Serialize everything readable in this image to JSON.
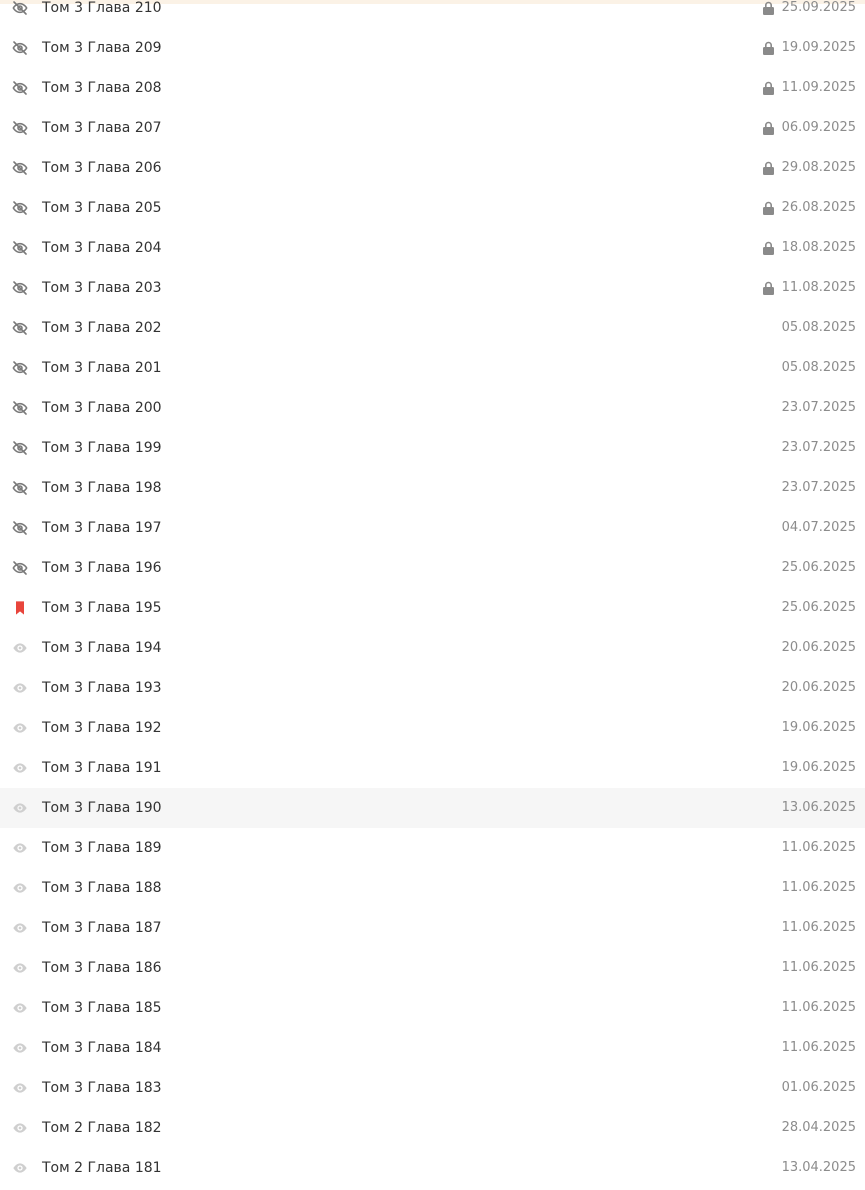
{
  "colors": {
    "title_text": "#333333",
    "date_text": "#8c8c8c",
    "icon_hidden": "#7a7a7a",
    "icon_eye": "#cfcfcf",
    "icon_bookmark": "#e8453c",
    "icon_lock": "#8a8a8a",
    "hover_row": "#f6f6f6",
    "top_strip": "#fbf2e6"
  },
  "chapters": [
    {
      "title": "Том 3 Глава 210",
      "date": "25.09.2025",
      "status_icon": "eye-off-icon",
      "locked": true
    },
    {
      "title": "Том 3 Глава 209",
      "date": "19.09.2025",
      "status_icon": "eye-off-icon",
      "locked": true
    },
    {
      "title": "Том 3 Глава 208",
      "date": "11.09.2025",
      "status_icon": "eye-off-icon",
      "locked": true
    },
    {
      "title": "Том 3 Глава 207",
      "date": "06.09.2025",
      "status_icon": "eye-off-icon",
      "locked": true
    },
    {
      "title": "Том 3 Глава 206",
      "date": "29.08.2025",
      "status_icon": "eye-off-icon",
      "locked": true
    },
    {
      "title": "Том 3 Глава 205",
      "date": "26.08.2025",
      "status_icon": "eye-off-icon",
      "locked": true
    },
    {
      "title": "Том 3 Глава 204",
      "date": "18.08.2025",
      "status_icon": "eye-off-icon",
      "locked": true
    },
    {
      "title": "Том 3 Глава 203",
      "date": "11.08.2025",
      "status_icon": "eye-off-icon",
      "locked": true
    },
    {
      "title": "Том 3 Глава 202",
      "date": "05.08.2025",
      "status_icon": "eye-off-icon",
      "locked": false
    },
    {
      "title": "Том 3 Глава 201",
      "date": "05.08.2025",
      "status_icon": "eye-off-icon",
      "locked": false
    },
    {
      "title": "Том 3 Глава 200",
      "date": "23.07.2025",
      "status_icon": "eye-off-icon",
      "locked": false
    },
    {
      "title": "Том 3 Глава 199",
      "date": "23.07.2025",
      "status_icon": "eye-off-icon",
      "locked": false
    },
    {
      "title": "Том 3 Глава 198",
      "date": "23.07.2025",
      "status_icon": "eye-off-icon",
      "locked": false
    },
    {
      "title": "Том 3 Глава 197",
      "date": "04.07.2025",
      "status_icon": "eye-off-icon",
      "locked": false
    },
    {
      "title": "Том 3 Глава 196",
      "date": "25.06.2025",
      "status_icon": "eye-off-icon",
      "locked": false
    },
    {
      "title": "Том 3 Глава 195",
      "date": "25.06.2025",
      "status_icon": "bookmark-icon",
      "locked": false
    },
    {
      "title": "Том 3 Глава 194",
      "date": "20.06.2025",
      "status_icon": "eye-icon",
      "locked": false
    },
    {
      "title": "Том 3 Глава 193",
      "date": "20.06.2025",
      "status_icon": "eye-icon",
      "locked": false
    },
    {
      "title": "Том 3 Глава 192",
      "date": "19.06.2025",
      "status_icon": "eye-icon",
      "locked": false
    },
    {
      "title": "Том 3 Глава 191",
      "date": "19.06.2025",
      "status_icon": "eye-icon",
      "locked": false
    },
    {
      "title": "Том 3 Глава 190",
      "date": "13.06.2025",
      "status_icon": "eye-icon",
      "locked": false,
      "hovered": true
    },
    {
      "title": "Том 3 Глава 189",
      "date": "11.06.2025",
      "status_icon": "eye-icon",
      "locked": false
    },
    {
      "title": "Том 3 Глава 188",
      "date": "11.06.2025",
      "status_icon": "eye-icon",
      "locked": false
    },
    {
      "title": "Том 3 Глава 187",
      "date": "11.06.2025",
      "status_icon": "eye-icon",
      "locked": false
    },
    {
      "title": "Том 3 Глава 186",
      "date": "11.06.2025",
      "status_icon": "eye-icon",
      "locked": false
    },
    {
      "title": "Том 3 Глава 185",
      "date": "11.06.2025",
      "status_icon": "eye-icon",
      "locked": false
    },
    {
      "title": "Том 3 Глава 184",
      "date": "11.06.2025",
      "status_icon": "eye-icon",
      "locked": false
    },
    {
      "title": "Том 3 Глава 183",
      "date": "01.06.2025",
      "status_icon": "eye-icon",
      "locked": false
    },
    {
      "title": "Том 2 Глава 182",
      "date": "28.04.2025",
      "status_icon": "eye-icon",
      "locked": false
    },
    {
      "title": "Том 2 Глава 181",
      "date": "13.04.2025",
      "status_icon": "eye-icon",
      "locked": false
    }
  ]
}
